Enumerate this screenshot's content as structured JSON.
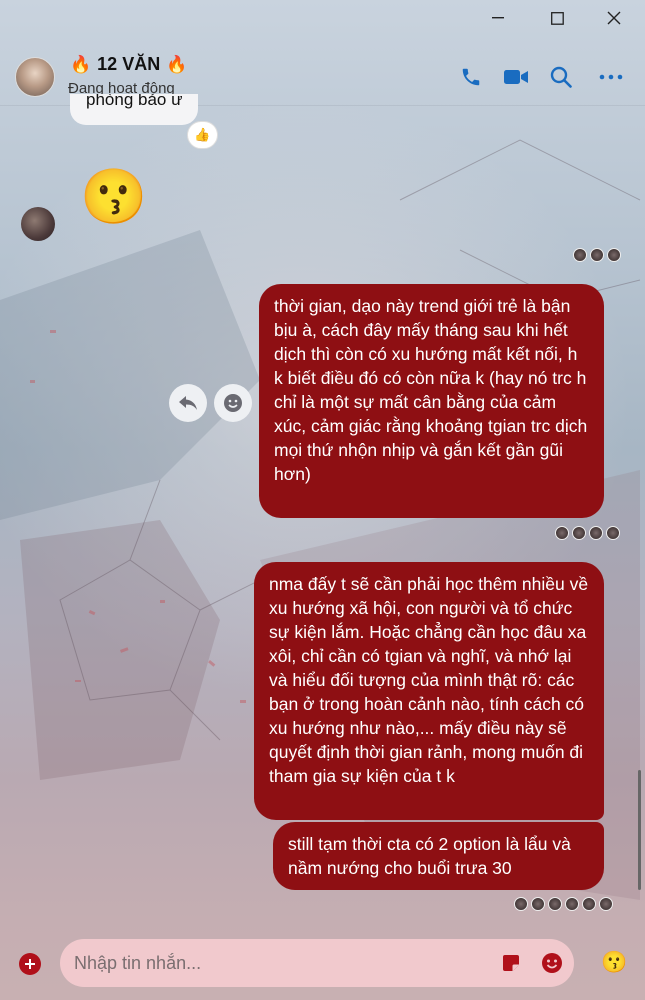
{
  "window": {
    "minimize_icon": "minimize-icon",
    "maximize_icon": "maximize-icon",
    "close_icon": "close-icon"
  },
  "header": {
    "title": "12 VĂN",
    "title_emoji": "🔥",
    "status": "Đang hoạt động",
    "actions": [
      "phone-icon",
      "video-camera-icon",
      "search-icon",
      "more-icon"
    ],
    "accent": "#1a6cc0"
  },
  "conversation": {
    "partial_message": "phòng bảo ư",
    "reaction": "👍",
    "emoji_message": "😗",
    "messages": [
      "thời gian, dạo này trend giới trẻ là bận bịu à, cách đây mấy tháng sau khi hết dịch thì còn có xu hướng mất kết nối, h k biết điều đó có còn nữa k (hay nó trc h chỉ là một sự mất cân bằng của cảm xúc, cảm giác rằng khoảng tgian trc dịch mọi thứ nhộn nhịp và gắn kết gần gũi hơn)",
      "nma đấy t sẽ cần phải học thêm nhiều về xu hướng xã hội, con người và tổ chức sự kiện lắm. Hoặc chẳng cần học đâu xa xôi, chỉ cần có tgian và nghĩ, và nhớ lại và hiểu đối tượng của mình thật rõ: các bạn ở trong hoàn cảnh nào, tính cách có xu hướng như nào,... mấy điều này sẽ quyết định thời gian rảnh, mong muốn đi tham gia sự kiện của t k",
      "still tạm thời cta có 2 option là lẩu và nầm nướng cho buổi trưa 30"
    ],
    "bubble_color": "#8e0f13"
  },
  "composer": {
    "placeholder": "Nhập tin nhắn...",
    "add_icon": "plus-circle-icon",
    "sticker_icon": "sticker-icon",
    "emoji_icon": "emoji-icon",
    "quick_reaction": "😗"
  }
}
